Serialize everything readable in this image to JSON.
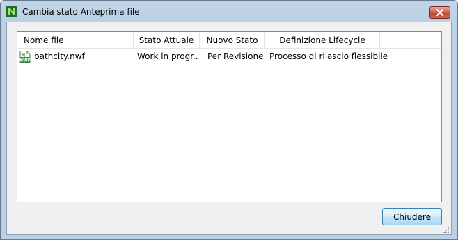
{
  "window": {
    "title": "Cambia stato Anteprima file"
  },
  "table": {
    "columns": [
      {
        "label": "Nome file"
      },
      {
        "label": "Stato Attuale"
      },
      {
        "label": "Nuovo Stato"
      },
      {
        "label": "Definizione Lifecycle"
      }
    ],
    "rows": [
      {
        "file_name": "bathcity.nwf",
        "file_icon": "nwf-file-icon",
        "current_state": "Work in progr...",
        "new_state": "Per Revisione",
        "lifecycle": "Processo di rilascio flessibile"
      }
    ]
  },
  "footer": {
    "close_label": "Chiudere"
  },
  "colors": {
    "title_bar": "#bcd0e6",
    "close_button": "#c0442c",
    "button_border": "#3c7fb1"
  }
}
